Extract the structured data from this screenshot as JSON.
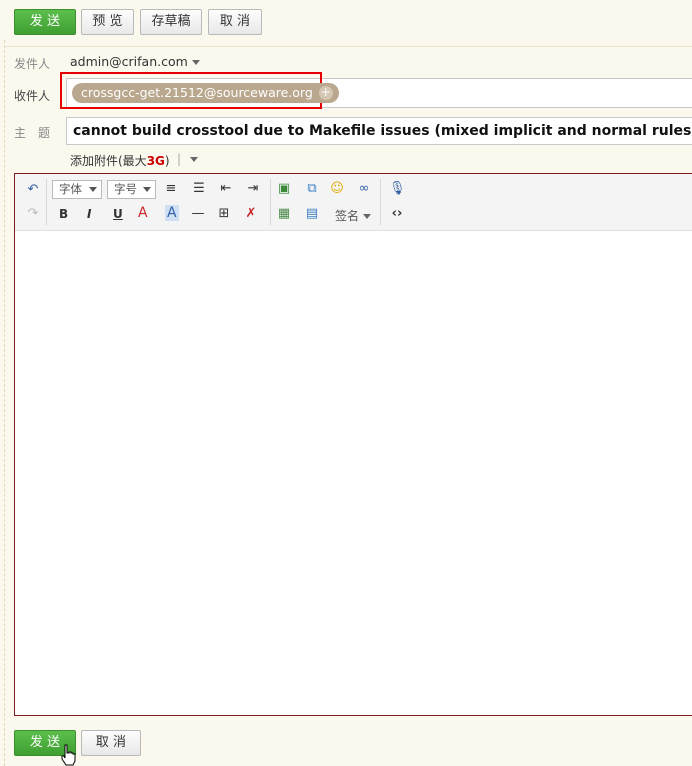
{
  "top_actions": {
    "send": "发 送",
    "preview": "预 览",
    "draft": "存草稿",
    "cancel": "取 消"
  },
  "sender": {
    "label": "发件人",
    "value": "admin@crifan.com"
  },
  "recipient": {
    "label": "收件人",
    "chip": "crossgcc-get.21512@sourceware.org",
    "chip_add": "+"
  },
  "subject": {
    "label": "主　题",
    "value": "cannot build crosstool due to Makefile issues (mixed implicit and normal rules)"
  },
  "attachment": {
    "text": "添加附件(最大",
    "max": "3G",
    "close": ")",
    "sep": "|"
  },
  "editor_toolbar": {
    "font_select": "字体",
    "size_select": "字号",
    "signature": "签名",
    "bold": "B",
    "italic": "I",
    "underline": "U",
    "font_color": "A",
    "highlight": "A"
  },
  "bottom_actions": {
    "send": "发 送",
    "cancel": "取 消"
  },
  "colors": {
    "accent_green": "#49ad3b",
    "highlight_red": "#e60000",
    "chip_bg": "#b9a88e"
  }
}
